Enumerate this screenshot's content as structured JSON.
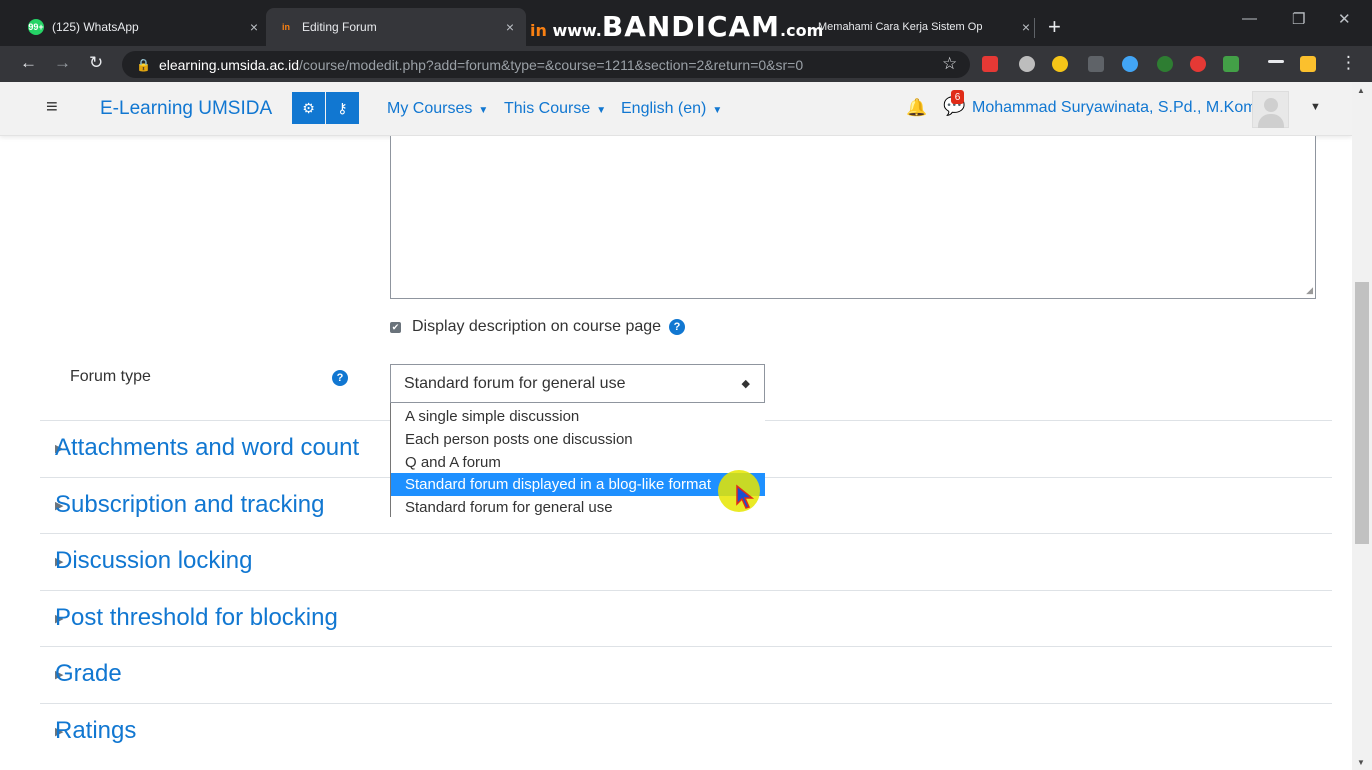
{
  "browser": {
    "tabs": [
      {
        "title": "(125) WhatsApp",
        "favicon": "whatsapp-icon",
        "favicon_text": "99+"
      },
      {
        "title": "Editing Forum",
        "favicon": "moodle-icon",
        "favicon_text": "in"
      },
      {
        "title": "Memahami Cara Kerja Sistem Op",
        "favicon": "moodle-icon",
        "favicon_text": "in"
      }
    ],
    "close_glyph": "×",
    "new_tab_glyph": "+",
    "watermark": {
      "prefix": "www.",
      "brand": "BANDICAM",
      "suffix": ".com"
    },
    "url": {
      "host": "elearning.umsida.ac.id",
      "path": "/course/modedit.php?add=forum&type=&course=1211&section=2&return=0&sr=0"
    }
  },
  "navbar": {
    "site_name": "E-Learning UMSIDA",
    "menus": [
      "My Courses",
      "This Course",
      "English (en)"
    ],
    "message_count": "6",
    "user_name": "Mohammad Suryawinata, S.Pd., M.Kom"
  },
  "form": {
    "display_description_label": "Display description on course page",
    "forum_type_label": "Forum type",
    "forum_type_value": "Standard forum for general use",
    "forum_type_options": [
      "A single simple discussion",
      "Each person posts one discussion",
      "Q and A forum",
      "Standard forum displayed in a blog-like format",
      "Standard forum for general use"
    ],
    "highlighted_option_index": 3
  },
  "sections": [
    "Attachments and word count",
    "Subscription and tracking",
    "Discussion locking",
    "Post threshold for blocking",
    "Grade",
    "Ratings"
  ],
  "colors": {
    "link": "#1177d1",
    "selected_option": "#1e90ff",
    "chrome_dark": "#202124"
  }
}
